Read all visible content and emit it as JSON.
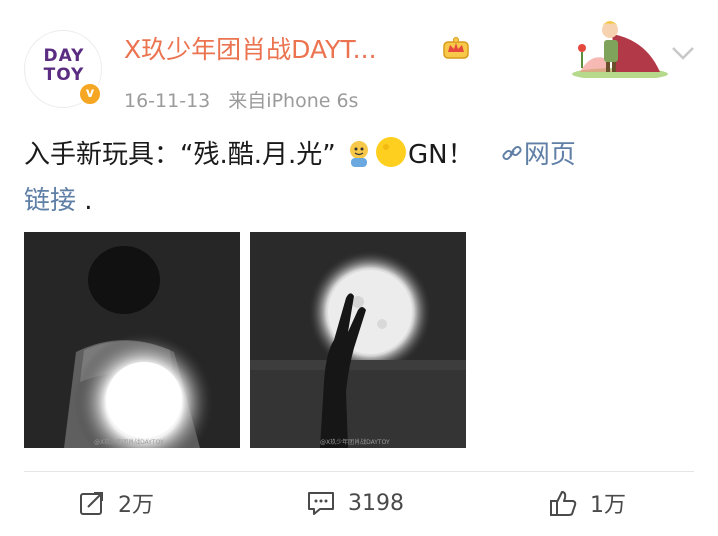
{
  "post": {
    "avatar_text": "DAY\nTOY",
    "verified_badge": "v",
    "username": "X玖少年团肖战DAYT...",
    "time": "16-11-13",
    "source": "来自iPhone 6s",
    "text_main": "入手新玩具：“残.酷.月.光”",
    "text_gn": "GN！",
    "link_label": "网页",
    "link_label2": "链接",
    "text_end": ".",
    "image_watermark": "@X玖少年团肖战DAYTOY",
    "icons": [
      "crown-icon",
      "chevron-down-icon",
      "link-icon",
      "repost-icon",
      "comment-icon",
      "like-icon"
    ]
  },
  "actions": {
    "repost_count": "2万",
    "comment_count": "3198",
    "like_count": "1万"
  }
}
